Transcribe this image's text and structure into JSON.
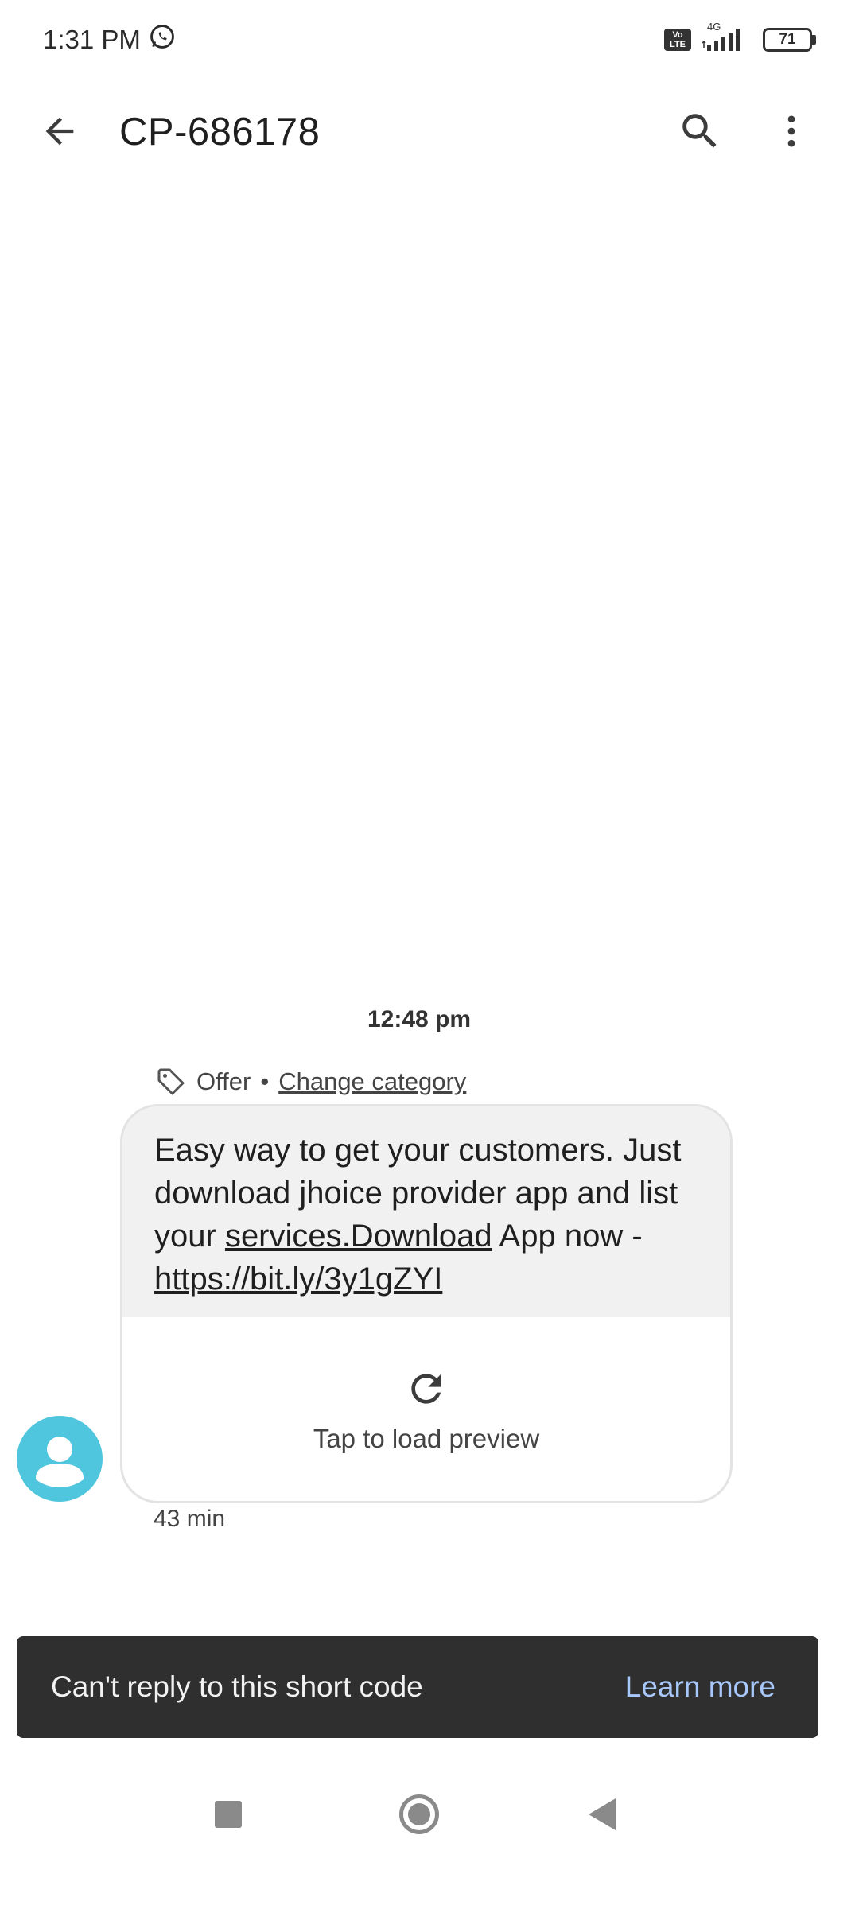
{
  "status_bar": {
    "time": "1:31 PM",
    "network": "4G",
    "volte": "Vo LTE",
    "battery": "71"
  },
  "app_bar": {
    "title": "CP-686178"
  },
  "conversation": {
    "date_divider": "12:48 pm",
    "category": "Offer",
    "category_separator": "•",
    "change_category": "Change category",
    "message": {
      "text_line1": "Easy way to get your customers. Just download jhoice provider app and list your ",
      "link1": "services.Download",
      "text_line2": " App now - ",
      "link2": "https://bit.ly/3y1gZYI"
    },
    "preview_label": "Tap to load preview",
    "message_time": "43 min"
  },
  "snackbar": {
    "text": "Can't reply to this short code",
    "action": "Learn more"
  },
  "colors": {
    "avatar": "#4fc6dd",
    "snackbar_bg": "#2f2f2f",
    "snackbar_action": "#a8c7fa",
    "bubble_bg": "#f1f1f1"
  }
}
